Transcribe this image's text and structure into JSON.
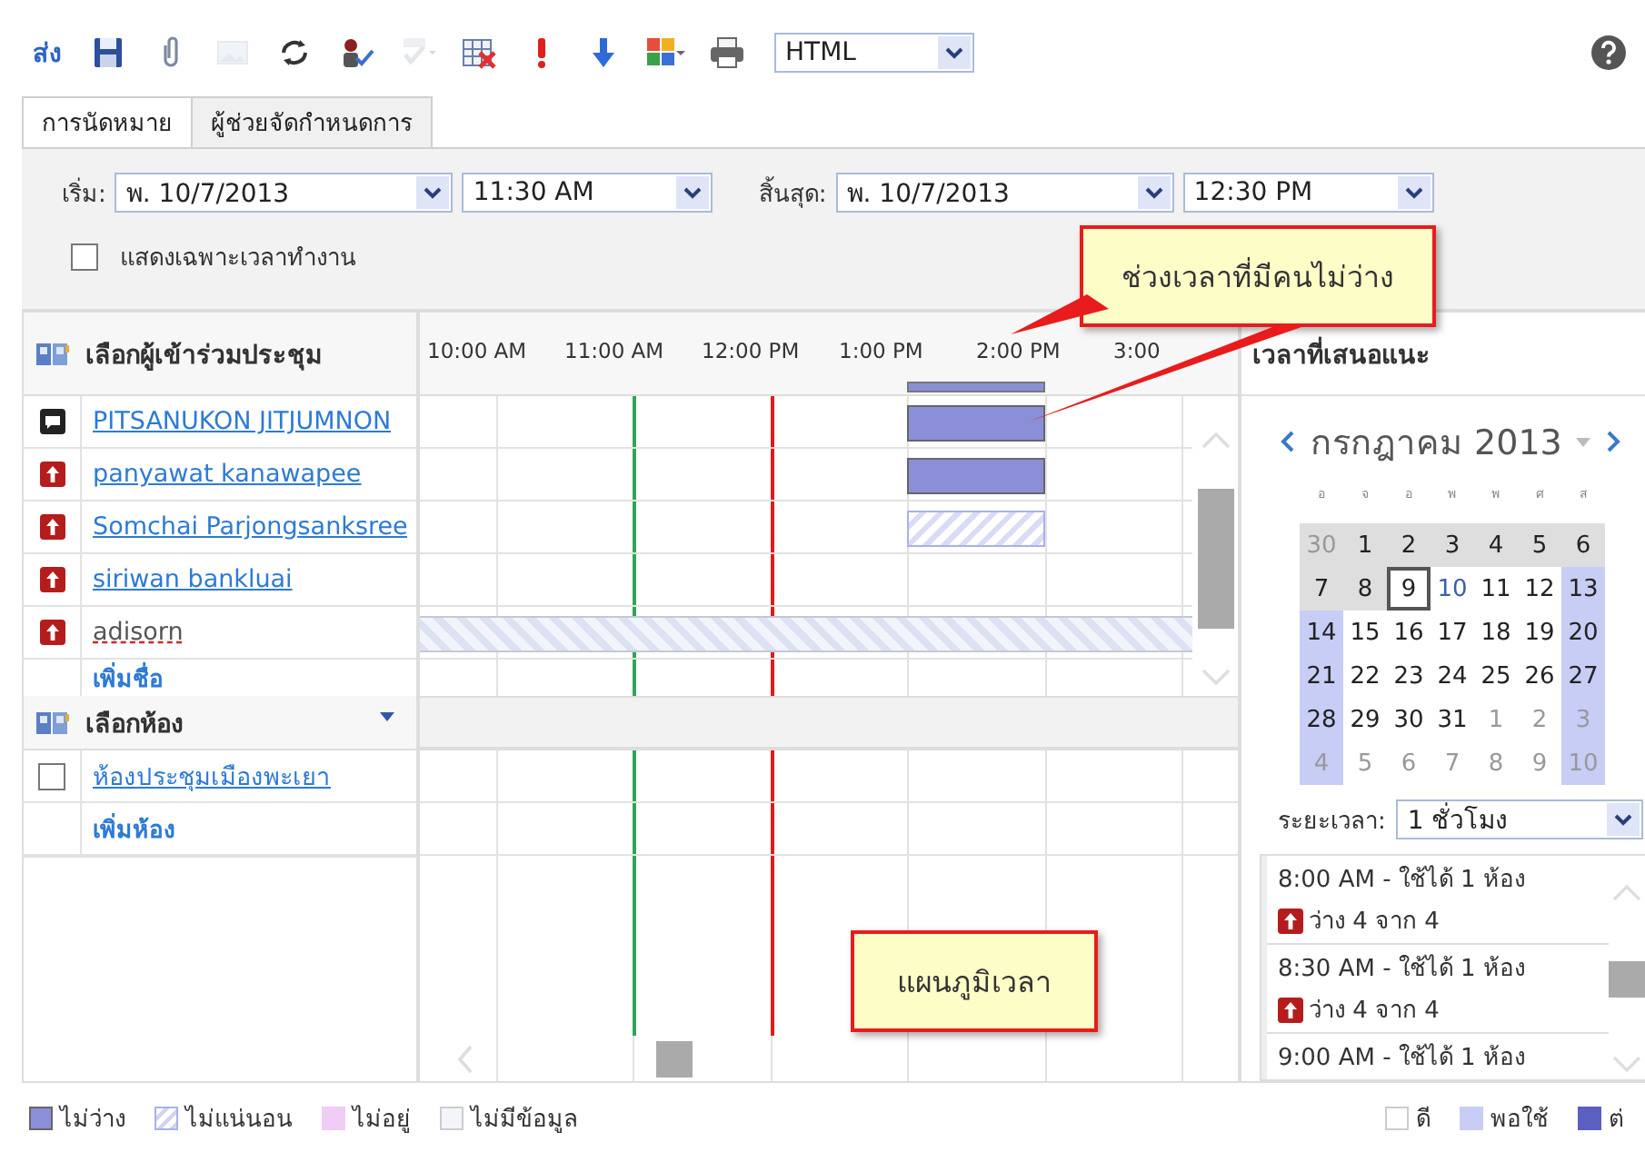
{
  "toolbar": {
    "send": "ส่ง",
    "format": "HTML",
    "icons": [
      {
        "kind": "save",
        "disabled": false
      },
      {
        "kind": "attach",
        "disabled": false
      },
      {
        "kind": "image",
        "disabled": true
      },
      {
        "kind": "sync",
        "disabled": false
      },
      {
        "kind": "check-names",
        "disabled": false
      },
      {
        "kind": "spelling",
        "disabled": true
      },
      {
        "kind": "delete-table",
        "disabled": false
      },
      {
        "kind": "importance",
        "disabled": false
      },
      {
        "kind": "low",
        "disabled": false
      },
      {
        "kind": "categories",
        "disabled": false
      },
      {
        "kind": "print",
        "disabled": false
      }
    ]
  },
  "tabs": [
    {
      "label": "การนัดหมาย",
      "selected": false
    },
    {
      "label": "ผู้ช่วยจัดกำหนดการ",
      "selected": true
    }
  ],
  "start": {
    "label": "เริ่ม:",
    "date": "พ. 10/7/2013",
    "time": "11:30 AM"
  },
  "end": {
    "label": "สิ้นสุด:",
    "date": "พ. 10/7/2013",
    "time": "12:30 PM"
  },
  "working_hours_only": {
    "label": "แสดงเฉพาะเวลาทำงาน",
    "checked": false
  },
  "attendees": {
    "title": "เลือกผู้เข้าร่วมประชุม",
    "add": "เพิ่มชื่อ",
    "people": [
      {
        "name": "PITSANUKON JITJUMNON",
        "kind": "organizer",
        "resolved": true,
        "slots": [
          {
            "kind": "free"
          },
          {
            "kind": "free"
          },
          {
            "kind": "free"
          },
          {
            "kind": "free"
          },
          {
            "kind": "free"
          },
          {
            "kind": "free"
          },
          {
            "kind": "free"
          },
          {
            "kind": "free"
          },
          {
            "kind": "busy"
          },
          {
            "kind": "busy"
          },
          {
            "kind": "free"
          },
          {
            "kind": "free"
          },
          {
            "kind": "free"
          }
        ]
      },
      {
        "name": "panyawat kanawapee",
        "kind": "required",
        "resolved": true,
        "slots": [
          {
            "kind": "free"
          },
          {
            "kind": "free"
          },
          {
            "kind": "free"
          },
          {
            "kind": "free"
          },
          {
            "kind": "free"
          },
          {
            "kind": "free"
          },
          {
            "kind": "free"
          },
          {
            "kind": "free"
          },
          {
            "kind": "busy"
          },
          {
            "kind": "busy"
          },
          {
            "kind": "free"
          },
          {
            "kind": "free"
          },
          {
            "kind": "free"
          }
        ]
      },
      {
        "name": "Somchai Parjongsanksree",
        "kind": "required",
        "resolved": true,
        "slots": [
          {
            "kind": "free"
          },
          {
            "kind": "free"
          },
          {
            "kind": "free"
          },
          {
            "kind": "free"
          },
          {
            "kind": "free"
          },
          {
            "kind": "free"
          },
          {
            "kind": "free"
          },
          {
            "kind": "free"
          },
          {
            "kind": "tentative"
          },
          {
            "kind": "tentative"
          },
          {
            "kind": "free"
          },
          {
            "kind": "free"
          },
          {
            "kind": "free"
          }
        ]
      },
      {
        "name": "siriwan bankluai",
        "kind": "required",
        "resolved": true,
        "slots": [
          {
            "kind": "free"
          },
          {
            "kind": "free"
          },
          {
            "kind": "free"
          },
          {
            "kind": "free"
          },
          {
            "kind": "free"
          },
          {
            "kind": "free"
          },
          {
            "kind": "free"
          },
          {
            "kind": "free"
          },
          {
            "kind": "free"
          },
          {
            "kind": "free"
          },
          {
            "kind": "free"
          },
          {
            "kind": "free"
          },
          {
            "kind": "free"
          }
        ]
      },
      {
        "name": "adisorn",
        "kind": "required",
        "resolved": false,
        "slots": [
          {
            "kind": "nodata"
          },
          {
            "kind": "nodata"
          },
          {
            "kind": "nodata"
          },
          {
            "kind": "nodata"
          },
          {
            "kind": "nodata"
          },
          {
            "kind": "nodata"
          },
          {
            "kind": "nodata"
          },
          {
            "kind": "nodata"
          },
          {
            "kind": "nodata"
          },
          {
            "kind": "nodata"
          },
          {
            "kind": "nodata"
          },
          {
            "kind": "nodata"
          },
          {
            "kind": "nodata"
          }
        ]
      }
    ]
  },
  "rooms": {
    "title": "เลือกห้อง",
    "add": "เพิ่มห้อง",
    "items": [
      {
        "name": "ห้องประชุมเมืองพะเยา",
        "checked": false
      }
    ]
  },
  "timeline": {
    "hours": [
      "10:00 AM",
      "11:00 AM",
      "12:00 PM",
      "1:00 PM",
      "2:00 PM",
      "3:00"
    ]
  },
  "suggestions": {
    "title": "เวลาที่เสนอแนะ",
    "month": "กรกฎาคม 2013",
    "weekdays": [
      "อ",
      "จ",
      "อ",
      "พ",
      "พ",
      "ศ",
      "ส"
    ],
    "days": [
      {
        "label": "30",
        "kind": "past",
        "outside": true,
        "selected": false,
        "today": false
      },
      {
        "label": "1",
        "kind": "past",
        "outside": false,
        "selected": false,
        "today": false
      },
      {
        "label": "2",
        "kind": "past",
        "outside": false,
        "selected": false,
        "today": false
      },
      {
        "label": "3",
        "kind": "past",
        "outside": false,
        "selected": false,
        "today": false
      },
      {
        "label": "4",
        "kind": "past",
        "outside": false,
        "selected": false,
        "today": false
      },
      {
        "label": "5",
        "kind": "past",
        "outside": false,
        "selected": false,
        "today": false
      },
      {
        "label": "6",
        "kind": "past",
        "outside": false,
        "selected": false,
        "today": false
      },
      {
        "label": "7",
        "kind": "past",
        "outside": false,
        "selected": false,
        "today": false
      },
      {
        "label": "8",
        "kind": "past",
        "outside": false,
        "selected": false,
        "today": false
      },
      {
        "label": "9",
        "kind": "workday",
        "outside": false,
        "selected": true,
        "today": false
      },
      {
        "label": "10",
        "kind": "workday",
        "outside": false,
        "selected": false,
        "today": true
      },
      {
        "label": "11",
        "kind": "workday",
        "outside": false,
        "selected": false,
        "today": false
      },
      {
        "label": "12",
        "kind": "workday",
        "outside": false,
        "selected": false,
        "today": false
      },
      {
        "label": "13",
        "kind": "weekend",
        "outside": false,
        "selected": false,
        "today": false
      },
      {
        "label": "14",
        "kind": "weekend",
        "outside": false,
        "selected": false,
        "today": false
      },
      {
        "label": "15",
        "kind": "workday",
        "outside": false,
        "selected": false,
        "today": false
      },
      {
        "label": "16",
        "kind": "workday",
        "outside": false,
        "selected": false,
        "today": false
      },
      {
        "label": "17",
        "kind": "workday",
        "outside": false,
        "selected": false,
        "today": false
      },
      {
        "label": "18",
        "kind": "workday",
        "outside": false,
        "selected": false,
        "today": false
      },
      {
        "label": "19",
        "kind": "workday",
        "outside": false,
        "selected": false,
        "today": false
      },
      {
        "label": "20",
        "kind": "weekend",
        "outside": false,
        "selected": false,
        "today": false
      },
      {
        "label": "21",
        "kind": "weekend",
        "outside": false,
        "selected": false,
        "today": false
      },
      {
        "label": "22",
        "kind": "workday",
        "outside": false,
        "selected": false,
        "today": false
      },
      {
        "label": "23",
        "kind": "workday",
        "outside": false,
        "selected": false,
        "today": false
      },
      {
        "label": "24",
        "kind": "workday",
        "outside": false,
        "selected": false,
        "today": false
      },
      {
        "label": "25",
        "kind": "workday",
        "outside": false,
        "selected": false,
        "today": false
      },
      {
        "label": "26",
        "kind": "workday",
        "outside": false,
        "selected": false,
        "today": false
      },
      {
        "label": "27",
        "kind": "weekend",
        "outside": false,
        "selected": false,
        "today": false
      },
      {
        "label": "28",
        "kind": "weekend",
        "outside": false,
        "selected": false,
        "today": false
      },
      {
        "label": "29",
        "kind": "workday",
        "outside": false,
        "selected": false,
        "today": false
      },
      {
        "label": "30",
        "kind": "workday",
        "outside": false,
        "selected": false,
        "today": false
      },
      {
        "label": "31",
        "kind": "workday",
        "outside": false,
        "selected": false,
        "today": false
      },
      {
        "label": "1",
        "kind": "workday",
        "outside": true,
        "selected": false,
        "today": false
      },
      {
        "label": "2",
        "kind": "workday",
        "outside": true,
        "selected": false,
        "today": false
      },
      {
        "label": "3",
        "kind": "weekend",
        "outside": true,
        "selected": false,
        "today": false
      },
      {
        "label": "4",
        "kind": "weekend",
        "outside": true,
        "selected": false,
        "today": false
      },
      {
        "label": "5",
        "kind": "workday",
        "outside": true,
        "selected": false,
        "today": false
      },
      {
        "label": "6",
        "kind": "workday",
        "outside": true,
        "selected": false,
        "today": false
      },
      {
        "label": "7",
        "kind": "workday",
        "outside": true,
        "selected": false,
        "today": false
      },
      {
        "label": "8",
        "kind": "workday",
        "outside": true,
        "selected": false,
        "today": false
      },
      {
        "label": "9",
        "kind": "workday",
        "outside": true,
        "selected": false,
        "today": false
      },
      {
        "label": "10",
        "kind": "weekend",
        "outside": true,
        "selected": false,
        "today": false
      }
    ],
    "duration_label": "ระยะเวลา:",
    "duration": "1 ชั่วโมง",
    "items": [
      {
        "time": "8:00 AM - ใช้ได้ 1 ห้อง",
        "availability": "ว่าง 4 จาก 4"
      },
      {
        "time": "8:30 AM - ใช้ได้ 1 ห้อง",
        "availability": "ว่าง 4 จาก 4"
      },
      {
        "time": "9:00 AM - ใช้ได้ 1 ห้อง"
      }
    ]
  },
  "legend": [
    {
      "kind": "busy",
      "label": "ไม่ว่าง"
    },
    {
      "kind": "tentative",
      "label": "ไม่แน่นอน"
    },
    {
      "kind": "away",
      "label": "ไม่อยู่"
    },
    {
      "kind": "nodata",
      "label": "ไม่มีข้อมูล"
    }
  ],
  "quality_legend": [
    {
      "kind": "good",
      "label": "ดี"
    },
    {
      "kind": "fair",
      "label": "พอใช้"
    },
    {
      "kind": "poor",
      "label": "ต่"
    }
  ],
  "callouts": [
    {
      "text": "ช่วงเวลาที่มีคนไม่ว่าง"
    },
    {
      "text": "แผนภูมิเวลา"
    }
  ]
}
